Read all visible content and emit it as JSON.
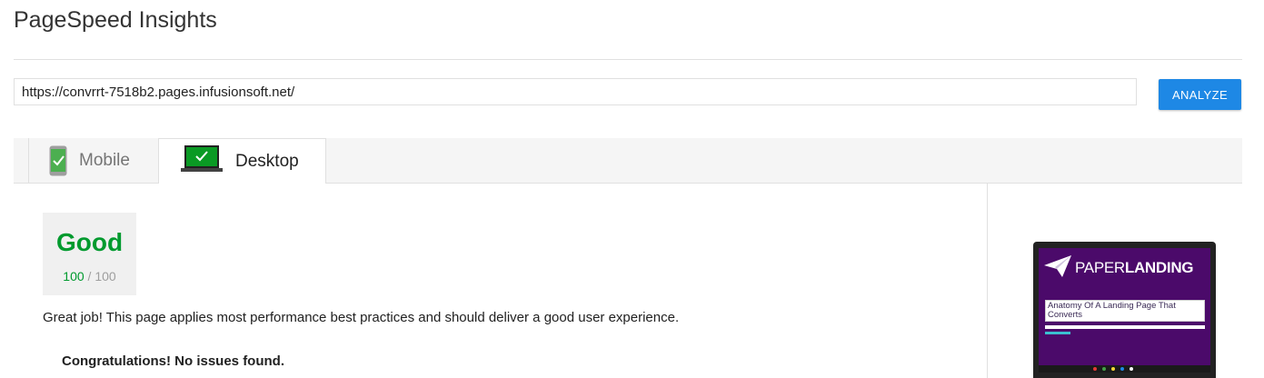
{
  "app": {
    "title": "PageSpeed Insights"
  },
  "search": {
    "url_value": "https://convrrt-7518b2.pages.infusionsoft.net/",
    "analyze_label": "ANALYZE"
  },
  "tabs": [
    {
      "label": "Mobile",
      "icon": "mobile-check-icon",
      "selected": false
    },
    {
      "label": "Desktop",
      "icon": "desktop-check-icon",
      "selected": true
    }
  ],
  "result": {
    "rating": "Good",
    "score": "100",
    "score_max": "/ 100",
    "summary": "Great job! This page applies most performance best practices and should deliver a good user experience.",
    "issues_heading": "Congratulations! No issues found."
  },
  "preview": {
    "brand_light": "PAPER",
    "brand_bold": "LANDING",
    "headline": "Anatomy Of A Landing Page That Converts"
  },
  "colors": {
    "accent": "#1e88e5",
    "good": "#009a2e",
    "preview_bg": "#4b0a6a"
  }
}
